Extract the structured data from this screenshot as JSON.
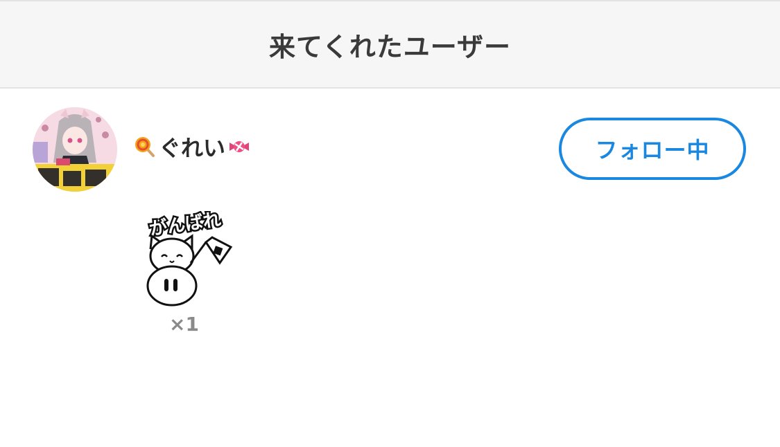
{
  "header": {
    "title": "来てくれたユーザー"
  },
  "user": {
    "name": "ぐれい",
    "prefix_emoji": "lollipop-icon",
    "suffix_emoji": "candy-icon",
    "follow_label": "フォロー中"
  },
  "gift": {
    "sticker_text": "がんばれ",
    "icon": "cat-ghost-flag-sticker",
    "count": "×1"
  },
  "colors": {
    "accent": "#1a87e0",
    "header_bg": "#f6f6f7",
    "count_text": "#8a8a8a"
  }
}
